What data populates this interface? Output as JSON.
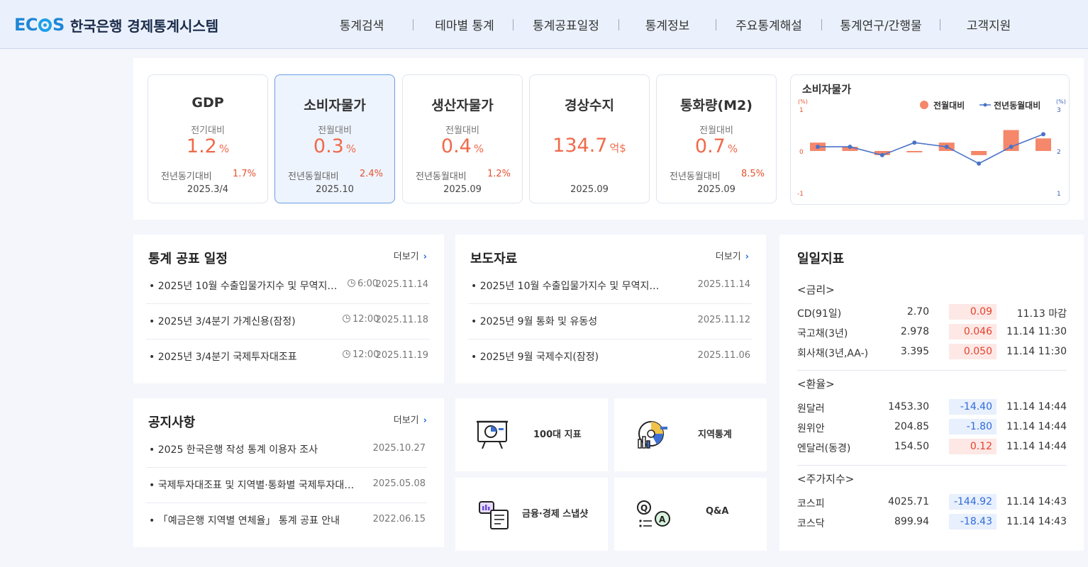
{
  "header": {
    "logo_text": "ECOS",
    "site_title": "한국은행 경제통계시스템",
    "nav": [
      "통계검색",
      "테마별 통계",
      "통계공표일정",
      "통계정보",
      "주요통계해설",
      "통계연구/간행물",
      "고객지원"
    ]
  },
  "indicators": [
    {
      "title": "GDP",
      "sublabel": "전기대비",
      "value": "1.2",
      "unit": "%",
      "yoy_label": "전년동기대비",
      "yoy_value": "1.7%",
      "period": "2025.3/4"
    },
    {
      "title": "소비자물가",
      "sublabel": "전월대비",
      "value": "0.3",
      "unit": "%",
      "yoy_label": "전년동월대비",
      "yoy_value": "2.4%",
      "period": "2025.10"
    },
    {
      "title": "생산자물가",
      "sublabel": "전월대비",
      "value": "0.4",
      "unit": "%",
      "yoy_label": "전년동월대비",
      "yoy_value": "1.2%",
      "period": "2025.09"
    },
    {
      "title": "경상수지",
      "sublabel": "",
      "value": "134.7",
      "unit": "억$",
      "yoy_label": "",
      "yoy_value": "",
      "period": "2025.09"
    },
    {
      "title": "통화량(M2)",
      "sublabel": "전월대비",
      "value": "0.7",
      "unit": "%",
      "yoy_label": "전년동월대비",
      "yoy_value": "8.5%",
      "period": "2025.09"
    }
  ],
  "mini_chart": {
    "title": "소비자물가",
    "left_unit": "(%)",
    "right_unit": "(%)",
    "left_ticks": [
      "1",
      "0",
      "-1"
    ],
    "right_ticks": [
      "3",
      "2",
      "1"
    ]
  },
  "chart_data": {
    "type": "bar",
    "title": "소비자물가",
    "series": [
      {
        "name": "전월대비",
        "type": "bar",
        "axis": "left",
        "color": "#f5876a",
        "values": [
          0.2,
          0.1,
          -0.1,
          0.0,
          0.2,
          -0.1,
          0.5,
          0.3
        ]
      },
      {
        "name": "전년동월대비",
        "type": "line",
        "axis": "right",
        "color": "#4a72c8",
        "values": [
          2.1,
          2.1,
          1.9,
          2.2,
          2.1,
          1.7,
          2.1,
          2.4
        ]
      }
    ],
    "ylim_left": [
      -1,
      1
    ],
    "ylim_right": [
      1,
      3
    ],
    "legend_position": "top-right"
  },
  "schedule": {
    "title": "통계 공표 일정",
    "more": "더보기",
    "items": [
      {
        "text": "2025년 10월 수출입물가지수 및 무역지…",
        "time": "6:00",
        "date": "2025.11.14"
      },
      {
        "text": "2025년 3/4분기 가계신용(잠정)",
        "time": "12:00",
        "date": "2025.11.18"
      },
      {
        "text": "2025년 3/4분기 국제투자대조표",
        "time": "12:00",
        "date": "2025.11.19"
      }
    ]
  },
  "press": {
    "title": "보도자료",
    "more": "더보기",
    "items": [
      {
        "text": "2025년 10월 수출입물가지수 및 무역지…",
        "date": "2025.11.14"
      },
      {
        "text": "2025년 9월 통화 및 유동성",
        "date": "2025.11.12"
      },
      {
        "text": "2025년 9월 국제수지(잠정)",
        "date": "2025.11.06"
      }
    ]
  },
  "notice": {
    "title": "공지사항",
    "more": "더보기",
    "items": [
      {
        "text": "2025 한국은행 작성 통계 이용자 조사",
        "date": "2025.10.27"
      },
      {
        "text": "국제투자대조표 및 지역별·통화별 국제투자대조…",
        "date": "2025.05.08"
      },
      {
        "text": "「예금은행 지역별 연체율」 통계 공표 안내",
        "date": "2022.06.15"
      }
    ]
  },
  "tiles": [
    {
      "label": "100대 지표",
      "icon": "presentation-chart-icon"
    },
    {
      "label": "지역통계",
      "icon": "regional-stats-icon"
    },
    {
      "label": "금융·경제 스냅샷",
      "icon": "snapshot-icon"
    },
    {
      "label": "Q&A",
      "icon": "qa-icon"
    }
  ],
  "daily": {
    "title": "일일지표",
    "sections": [
      {
        "name": "<금리>",
        "rows": [
          {
            "name": "CD(91일)",
            "value": "2.70",
            "change": "0.09",
            "dir": "up",
            "time": "11.13 마감"
          },
          {
            "name": "국고채(3년)",
            "value": "2.978",
            "change": "0.046",
            "dir": "up",
            "time": "11.14 11:30"
          },
          {
            "name": "회사채(3년,AA-)",
            "value": "3.395",
            "change": "0.050",
            "dir": "up",
            "time": "11.14 11:30"
          }
        ]
      },
      {
        "name": "<환율>",
        "rows": [
          {
            "name": "원달러",
            "value": "1453.30",
            "change": "-14.40",
            "dir": "dn",
            "time": "11.14 14:44"
          },
          {
            "name": "원위안",
            "value": "204.85",
            "change": "-1.80",
            "dir": "dn",
            "time": "11.14 14:44"
          },
          {
            "name": "엔달러(동경)",
            "value": "154.50",
            "change": "0.12",
            "dir": "up",
            "time": "11.14 14:44"
          }
        ]
      },
      {
        "name": "<주가지수>",
        "rows": [
          {
            "name": "코스피",
            "value": "4025.71",
            "change": "-144.92",
            "dir": "dn",
            "time": "11.14 14:43"
          },
          {
            "name": "코스닥",
            "value": "899.94",
            "change": "-18.43",
            "dir": "dn",
            "time": "11.14 14:43"
          }
        ]
      }
    ]
  }
}
